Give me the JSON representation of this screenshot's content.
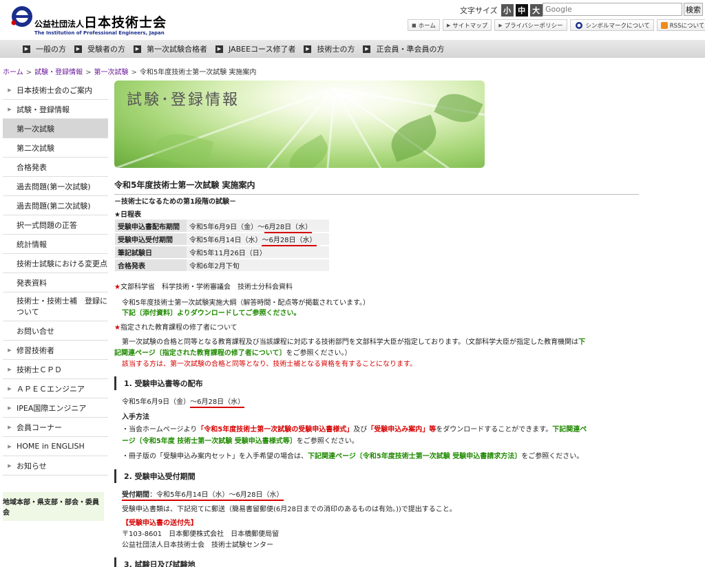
{
  "header": {
    "org_type": "公益社団法人",
    "org_name": "日本技術士会",
    "org_english": "The Institution of Professional Engineers, Japan",
    "font_size_label": "文字サイズ",
    "font_sizes": [
      "小",
      "中",
      "大"
    ],
    "search_placeholder": "Google",
    "search_button": "検索",
    "links": [
      "ホーム",
      "サイトマップ",
      "プライバシーポリシー",
      "シンボルマークについて",
      "RSSについて"
    ]
  },
  "gnav": [
    "一般の方",
    "受験者の方",
    "第一次試験合格者",
    "JABEEコース修了者",
    "技術士の方",
    "正会員・準会員の方"
  ],
  "breadcrumb": [
    "ホーム",
    "試験・登録情報",
    "第一次試験",
    "令和5年度技術士第一次試験 実施案内"
  ],
  "sidebar": {
    "items": [
      {
        "label": "日本技術士会のご案内"
      },
      {
        "label": "試験・登録情報"
      },
      {
        "label": "第一次試験"
      },
      {
        "label": "第二次試験"
      },
      {
        "label": "合格発表"
      },
      {
        "label": "過去問題(第一次試験)"
      },
      {
        "label": "過去問題(第二次試験)"
      },
      {
        "label": "択一式問題の正答"
      },
      {
        "label": "統計情報"
      },
      {
        "label": "技術士試験における変更点"
      },
      {
        "label": "発表資料"
      },
      {
        "label": "技術士・技術士補　登録について"
      },
      {
        "label": "お問い合せ"
      },
      {
        "label": "修習技術者"
      },
      {
        "label": "技術士ＣＰＤ"
      },
      {
        "label": "ＡＰＥＣエンジニア"
      },
      {
        "label": "IPEA国際エンジニア"
      },
      {
        "label": "会員コーナー"
      },
      {
        "label": "HOME in ENGLISH"
      },
      {
        "label": "お知らせ"
      }
    ],
    "regional": "地域本部・県支部・部会・委員会"
  },
  "banner_title": "試験･登録情報",
  "main": {
    "title": "令和5年度技術士第一次試験 実施案内",
    "subtitle": "－技術士になるための第1段階の試験－",
    "schedule_label": "★日程表",
    "schedule": [
      {
        "label": "受験申込書配布期間",
        "value": "令和5年6月9日（金）～",
        "value_ul": "6月28日（水）"
      },
      {
        "label": "受験申込受付期間",
        "value": "令和5年6月14日（水）",
        "value_ul": "～6月28日（水）"
      },
      {
        "label": "筆記試験日",
        "value": "令和5年11月26日（日）",
        "value_ul": ""
      },
      {
        "label": "合格発表",
        "value": "令和6年2月下旬",
        "value_ul": ""
      }
    ],
    "mext_heading": "文部科学省　科学技術・学術審議会　技術士分科会資料",
    "mext_line1": "令和5年度技術士第一次試験実施大綱（解答時間・配点等が掲載されています。）",
    "mext_line2": "下記〔添付資料〕よりダウンロードしてご参照ください。",
    "edu_heading": "指定された教育課程の修了者について",
    "edu_line1a": "第一次試験の合格と同等となる教育課程及び当該課程に対応する技術部門を文部科学大臣が指定しております。（文部科学大臣が指定した教育機関は",
    "edu_line1b": "下",
    "edu_line2a": "記関連ページ〔指定された教育課程の修了者について〕",
    "edu_line2b": "をご参照ください。）",
    "edu_line3": "該当する方は、第一次試験の合格と同等となり、技術士補となる資格を有することになります。",
    "s1_title": "1.  受験申込書等の配布",
    "s1_date_a": "令和5年6月9日（金）",
    "s1_date_b": "～6月28日（水）",
    "s1_method": "入手方法",
    "s1_b1a": "・当会ホームページより",
    "s1_b1b": "「令和5年度技術士第一次試験の受験申込書様式」",
    "s1_b1c": "及び",
    "s1_b1d": "「受験申込み案内」等",
    "s1_b1e": "をダウンロードすることができます。",
    "s1_b1f": "下記関連ペ",
    "s1_b1g": "ージ〔令和5年度 技術士第一次試験 受験申込書様式等〕",
    "s1_b1h": "をご参照ください。",
    "s1_b2a": "・冊子版の「受験申込み案内セット」を入手希望の場合は、",
    "s1_b2b": "下記関連ページ〔令和5年度技術士第一次試験 受験申込書請求方法〕",
    "s1_b2c": "をご参照ください。",
    "s2_title": "2.  受験申込受付期間",
    "s2_period_label": "受付期間",
    "s2_period_value": "：令和5年6月14日（水）～6月28日（水）",
    "s2_line1": "受験申込書類は、下記宛てに郵送（簡易書留郵便(6月28日までの消印のあるものは有効。))で提出すること。",
    "s2_dest": "【受験申込書の送付先】",
    "s2_addr1": "〒103-8601　日本郵便株式会社　日本橋郵便局留",
    "s2_addr2": "公益社団法人日本技術士会　技術士試験センター",
    "s3_title": "3.  試験日及び試験地"
  }
}
